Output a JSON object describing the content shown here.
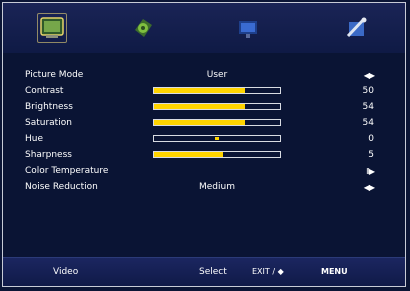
{
  "tabs": [
    {
      "name": "Picture",
      "icon": "picture-icon",
      "active": true
    },
    {
      "name": "Sound",
      "icon": "sound-icon",
      "active": false
    },
    {
      "name": "Channel",
      "icon": "channel-icon",
      "active": false
    },
    {
      "name": "Setup",
      "icon": "setup-icon",
      "active": false
    }
  ],
  "menu": {
    "picture_mode": {
      "label": "Picture Mode",
      "value": "User",
      "arrow": "◀▶"
    },
    "contrast": {
      "label": "Contrast",
      "value": "50",
      "level": 0.72
    },
    "brightness": {
      "label": "Brightness",
      "value": "54",
      "level": 0.72
    },
    "saturation": {
      "label": "Saturation",
      "value": "54",
      "level": 0.72
    },
    "hue": {
      "label": "Hue",
      "value": "0"
    },
    "sharpness": {
      "label": "Sharpness",
      "value": "5",
      "level": 0.55
    },
    "color_temperature": {
      "label": "Color Temperature",
      "arrow": "II▶"
    },
    "noise_reduction": {
      "label": "Noise Reduction",
      "value": "Medium",
      "arrow": "◀▶"
    }
  },
  "footer": {
    "source": "Video",
    "select": "Select",
    "nav_hint": "EXIT / ◆",
    "menu": "MENU"
  },
  "colors": {
    "background": "#0a1434",
    "bar_fill": "#ffd400",
    "header": "#1a2456"
  }
}
